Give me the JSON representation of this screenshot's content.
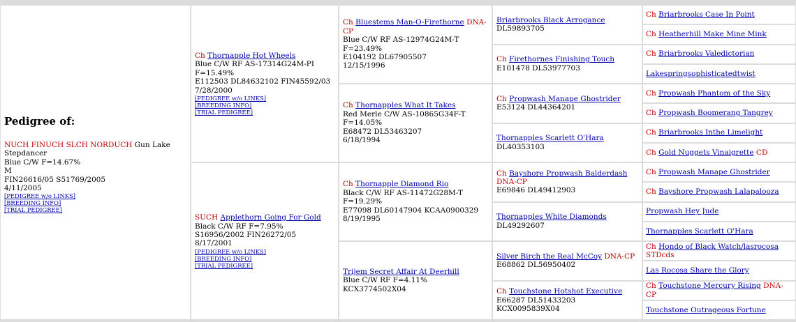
{
  "subject": {
    "heading": "Pedigree of:",
    "titles": "NUCH FINUCH SLCH NORDUCH",
    "name": "Gun Lake Stepdancer",
    "color_line": "Blue C/W F=14.67%",
    "sex": "M",
    "regs": "FIN26616/05 S51769/2005",
    "dob": "4/11/2005",
    "links": [
      "[PEDIGREE w/o LINKS]",
      "[BREEDING INFO]",
      "[TRIAL PEDIGREE]"
    ]
  },
  "parents": [
    {
      "title": "Ch",
      "name": "Thornapple Hot Wheels",
      "suffix": "",
      "lines": [
        "Blue C/W RF AS-17314G24M-PI",
        "F=15.49%",
        "E112503 DL84632102 FIN45592/03",
        "7/28/2000"
      ],
      "links": [
        "[PEDIGREE w/o LINKS]",
        "[BREEDING INFO]",
        "[TRIAL PEDIGREE]"
      ]
    },
    {
      "title": "SUCH",
      "name": "Applethorn Going For Gold",
      "suffix": "",
      "lines": [
        "Black C/W RF F=7.95%",
        "S16956/2002 FIN26272/05",
        "8/17/2001"
      ],
      "links": [
        "[PEDIGREE w/o LINKS]",
        "[BREEDING INFO]",
        "[TRIAL PEDIGREE]"
      ]
    }
  ],
  "grandparents": [
    {
      "title": "Ch",
      "name": "Bluestems Man-O-Firethorne",
      "suffix": "DNA-CP",
      "lines": [
        "Blue C/W RF AS-12974G24M-T",
        "F=23.49%",
        "E104192 DL67905507",
        "12/15/1996"
      ]
    },
    {
      "title": "Ch",
      "name": "Thornapples What It Takes",
      "suffix": "",
      "lines": [
        "Red Merle C/W AS-10865G34F-T",
        "F=14.05%",
        "E68472 DL53463207",
        "6/18/1994"
      ]
    },
    {
      "title": "Ch",
      "name": "Thornapple Diamond Rio",
      "suffix": "",
      "lines": [
        "Black C/W RF AS-11472G28M-T",
        "F=19.29%",
        "E77098 DL60147904 KCAA0900329",
        "8/19/1995"
      ]
    },
    {
      "title": "",
      "name": "Trijem Secret Affair At Deerhill",
      "suffix": "",
      "lines": [
        "Blue C/W RF F=4.11%",
        "KCX3774502X04"
      ]
    }
  ],
  "great_grandparents": [
    {
      "title": "",
      "name": "Briarbrooks Black Arrogance",
      "suffix": "",
      "lines": [
        "DL59893705"
      ]
    },
    {
      "title": "Ch",
      "name": "Firethornes Finishing Touch",
      "suffix": "",
      "lines": [
        "E101478 DL53977703"
      ]
    },
    {
      "title": "Ch",
      "name": "Propwash Manape Ghostrider",
      "suffix": "",
      "lines": [
        "E53124 DL44364201"
      ]
    },
    {
      "title": "",
      "name": "Thornapples Scarlett O'Hara",
      "suffix": "",
      "lines": [
        "DL40353103"
      ]
    },
    {
      "title": "Ch",
      "name": "Bayshore Propwash Balderdash",
      "suffix": "DNA-CP",
      "lines": [
        "E69846 DL49412903"
      ]
    },
    {
      "title": "",
      "name": "Thornapples White Diamonds",
      "suffix": "",
      "lines": [
        "DL49292607"
      ]
    },
    {
      "title": "",
      "name": "Silver Birch the Real McCoy",
      "suffix": "DNA-CP",
      "lines": [
        "E68862 DL56950402"
      ]
    },
    {
      "title": "Ch",
      "name": "Touchstone Hotshot Executive",
      "suffix": "",
      "lines": [
        "E66287 DL51433203 KCX0095839X04"
      ]
    }
  ],
  "gen4": [
    {
      "title": "Ch",
      "name": "Briarbrooks Case In Point",
      "suffix": ""
    },
    {
      "title": "Ch",
      "name": "Heatherhill Make Mine Mink",
      "suffix": ""
    },
    {
      "title": "Ch",
      "name": "Briarbrooks Valedictorian",
      "suffix": ""
    },
    {
      "title": "",
      "name": "Lakespringsophisticatedtwist",
      "suffix": ""
    },
    {
      "title": "Ch",
      "name": "Propwash Phantom of the Sky",
      "suffix": ""
    },
    {
      "title": "Ch",
      "name": "Propwash Boomerang Tangrey",
      "suffix": ""
    },
    {
      "title": "Ch",
      "name": "Briarbrooks Inthe Limelight",
      "suffix": ""
    },
    {
      "title": "Ch",
      "name": "Gold Nuggets Vinaigrette",
      "suffix": "CD"
    },
    {
      "title": "Ch",
      "name": "Propwash Manape Ghostrider",
      "suffix": ""
    },
    {
      "title": "Ch",
      "name": "Bayshore Propwash Lalapalooza",
      "suffix": ""
    },
    {
      "title": "",
      "name": "Propwash Hey Jude",
      "suffix": ""
    },
    {
      "title": "",
      "name": "Thornapples Scarlett O'Hara",
      "suffix": ""
    },
    {
      "title": "Ch",
      "name": "Hondo of Black Watch/lasrocosa",
      "suffix": "STDcds"
    },
    {
      "title": "",
      "name": "Las Rocosa Share the Glory",
      "suffix": ""
    },
    {
      "title": "Ch",
      "name": "Touchstone Mercury Rising",
      "suffix": "DNA-CP"
    },
    {
      "title": "",
      "name": "Touchstone Outrageous Fortune",
      "suffix": ""
    }
  ]
}
